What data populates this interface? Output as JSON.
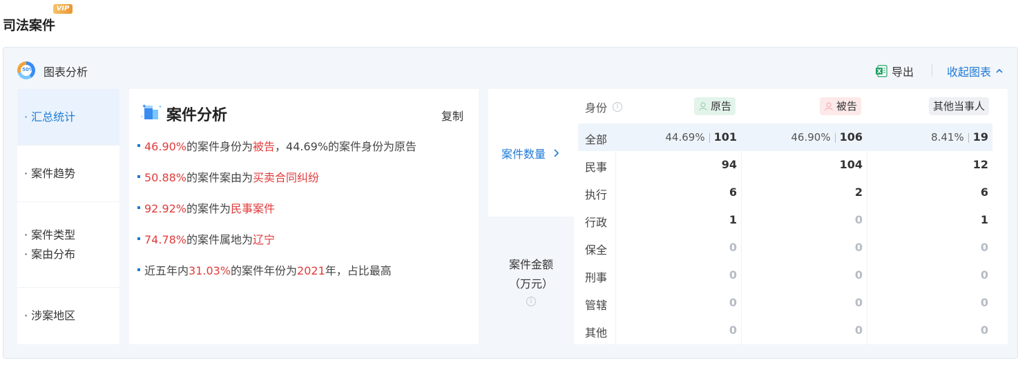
{
  "page": {
    "title": "司法案件",
    "vip": "VIP"
  },
  "panel": {
    "logo_text": "50%",
    "title": "图表分析",
    "export_label": "导出",
    "collapse_label": "收起图表"
  },
  "nav": [
    {
      "label": "· 汇总统计"
    },
    {
      "label": "· 案件趋势"
    },
    {
      "label": "· 案件类型"
    },
    {
      "label": "· 案由分布"
    },
    {
      "label": "· 涉案地区"
    }
  ],
  "analysis": {
    "title": "案件分析",
    "copy_label": "复制",
    "b1": {
      "p1": "46.90%",
      "t1": "的案件身份为",
      "r1": "被告",
      "t2": "，44.69%的案件身份为原告"
    },
    "b2": {
      "p1": "50.88%",
      "t1": "的案件案由为",
      "r1": "买卖合同纠纷"
    },
    "b3": {
      "p1": "92.92%",
      "t1": "的案件为",
      "r1": "民事案件"
    },
    "b4": {
      "p1": "74.78%",
      "t1": "的案件属地为",
      "r1": "辽宁"
    },
    "b5": {
      "t0": "近五年内",
      "p1": "31.03%",
      "t1": "的案件年份为",
      "r1": "2021",
      "t2": "年，占比最高"
    }
  },
  "table": {
    "count_label": "案件数量",
    "amount_label_1": "案件金额",
    "amount_label_2": "（万元）",
    "identity_label": "身份",
    "columns": {
      "plaintiff": "原告",
      "defendant": "被告",
      "other": "其他当事人"
    },
    "total": {
      "label": "全部",
      "plaintiff_pct": "44.69%",
      "plaintiff": "101",
      "defendant_pct": "46.90%",
      "defendant": "106",
      "other_pct": "8.41%",
      "other": "19"
    },
    "rows": [
      {
        "label": "民事",
        "plaintiff": "94",
        "defendant": "104",
        "other": "12"
      },
      {
        "label": "执行",
        "plaintiff": "6",
        "defendant": "2",
        "other": "6"
      },
      {
        "label": "行政",
        "plaintiff": "1",
        "defendant": "0",
        "other": "1"
      },
      {
        "label": "保全",
        "plaintiff": "0",
        "defendant": "0",
        "other": "0"
      },
      {
        "label": "刑事",
        "plaintiff": "0",
        "defendant": "0",
        "other": "0"
      },
      {
        "label": "管辖",
        "plaintiff": "0",
        "defendant": "0",
        "other": "0"
      },
      {
        "label": "其他",
        "plaintiff": "0",
        "defendant": "0",
        "other": "0"
      }
    ]
  },
  "colors": {
    "accent": "#1f7ad6",
    "highlight_red": "#e03b3b"
  }
}
